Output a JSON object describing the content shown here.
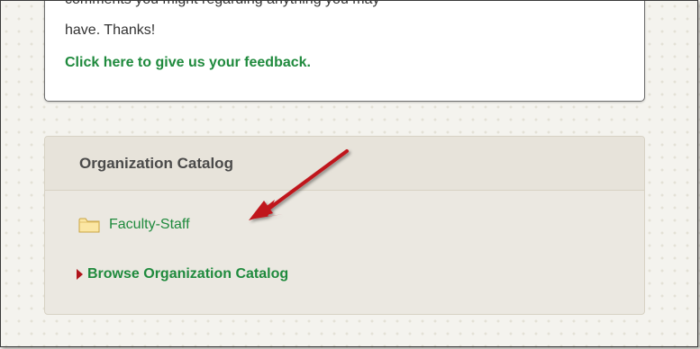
{
  "feedback": {
    "cut_text": "comments you might regarding anything you may",
    "text": "have.  Thanks!",
    "link_label": "Click here to give us your feedback."
  },
  "catalog": {
    "title": "Organization Catalog",
    "items": [
      {
        "label": "Faculty-Staff",
        "icon": "folder-icon"
      }
    ],
    "browse_label": "Browse Organization Catalog"
  },
  "colors": {
    "link_green": "#1f8a3d",
    "arrow_red": "#c0141c",
    "panel_bg": "#ebe8e1"
  }
}
